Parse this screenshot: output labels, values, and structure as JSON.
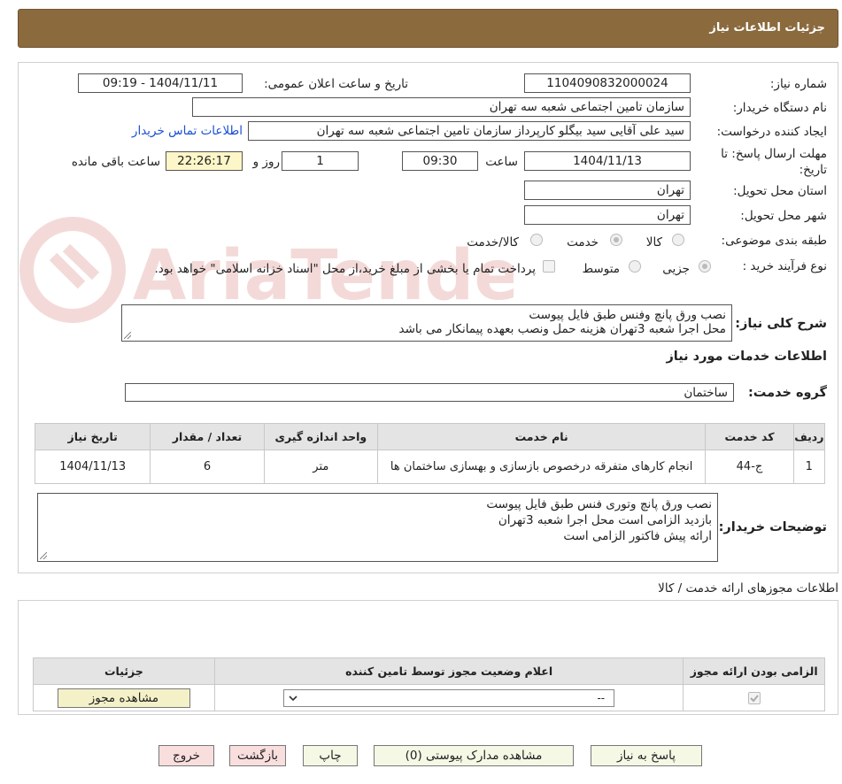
{
  "header": {
    "title": "جزئیات اطلاعات نیاز"
  },
  "form": {
    "need_number_label": "شماره نیاز:",
    "need_number": "1104090832000024",
    "announce_label": "تاریخ و ساعت اعلان عمومی:",
    "announce_value": "1404/11/11 - 09:19",
    "buyer_org_label": "نام دستگاه خریدار:",
    "buyer_org": "سازمان تامین اجتماعی شعبه سه تهران",
    "creator_label": "ایجاد کننده درخواست:",
    "creator": "سید علی آقایی سید بیگلو کارپرداز سازمان تامین اجتماعی شعبه سه تهران",
    "contact_link": "اطلاعات تماس خریدار",
    "deadline_label_1": "مهلت ارسال پاسخ: تا",
    "deadline_label_2": "تاریخ:",
    "deadline_date": "1404/11/13",
    "time_label": "ساعت",
    "deadline_time": "09:30",
    "days_value": "1",
    "days_label": "روز و",
    "remaining_time": "22:26:17",
    "remaining_label": "ساعت باقی مانده",
    "province_label": "استان محل تحویل:",
    "province": "تهران",
    "city_label": "شهر محل تحویل:",
    "city": "تهران",
    "category_label": "طبقه بندی موضوعی:",
    "category_options": [
      "کالا",
      "خدمت",
      "کالا/خدمت"
    ],
    "purchase_type_label": "نوع فرآیند خرید :",
    "purchase_options": [
      "جزیی",
      "متوسط"
    ],
    "payment_note": "پرداخت تمام یا بخشی از مبلغ خرید،از محل \"اسناد خزانه اسلامی\" خواهد بود.",
    "summary_label": "شرح کلی نیاز:",
    "summary_line1": "نصب ورق پانچ وفنس طبق فایل پیوست",
    "summary_line2": "محل اجرا شعبه 3تهران هزینه حمل ونصب بعهده پیمانکار می باشد",
    "services_title": "اطلاعات خدمات مورد نیاز",
    "service_group_label": "گروه خدمت:",
    "service_group": "ساختمان"
  },
  "service_table": {
    "headers": [
      "ردیف",
      "کد خدمت",
      "نام خدمت",
      "واحد اندازه گیری",
      "تعداد / مقدار",
      "تاریخ نیاز"
    ],
    "rows": [
      {
        "row": "1",
        "code": "ج-44",
        "name": "انجام کارهای متفرقه درخصوص بازسازی و بهسازی ساختمان ها",
        "unit": "متر",
        "qty": "6",
        "date": "1404/11/13"
      }
    ]
  },
  "buyer_notes": {
    "label": "توضیحات خریدار:",
    "line1": "نصب ورق پانچ وتوری فنس طبق فایل پیوست",
    "line2": "بازدید الزامی است محل اجرا شعبه 3تهران",
    "line3": "ارائه پیش فاکتور الزامی است"
  },
  "permits": {
    "title": "اطلاعات مجوزهای ارائه خدمت / کالا",
    "headers": [
      "الزامی بودن ارائه مجوز",
      "اعلام وضعیت مجوز توسط تامین کننده",
      "جزئیات"
    ],
    "select_value": "--",
    "view_button": "مشاهده مجوز"
  },
  "buttons": {
    "reply": "پاسخ به نیاز",
    "attachments": "مشاهده مدارک پیوستی (0)",
    "print": "چاپ",
    "back": "بازگشت",
    "exit": "خروج"
  },
  "watermark_text": "AriaTender.neT",
  "colors": {
    "header_bg": "#8b6a3e",
    "link": "#1a4fd6",
    "watermark": "#c0392b"
  }
}
